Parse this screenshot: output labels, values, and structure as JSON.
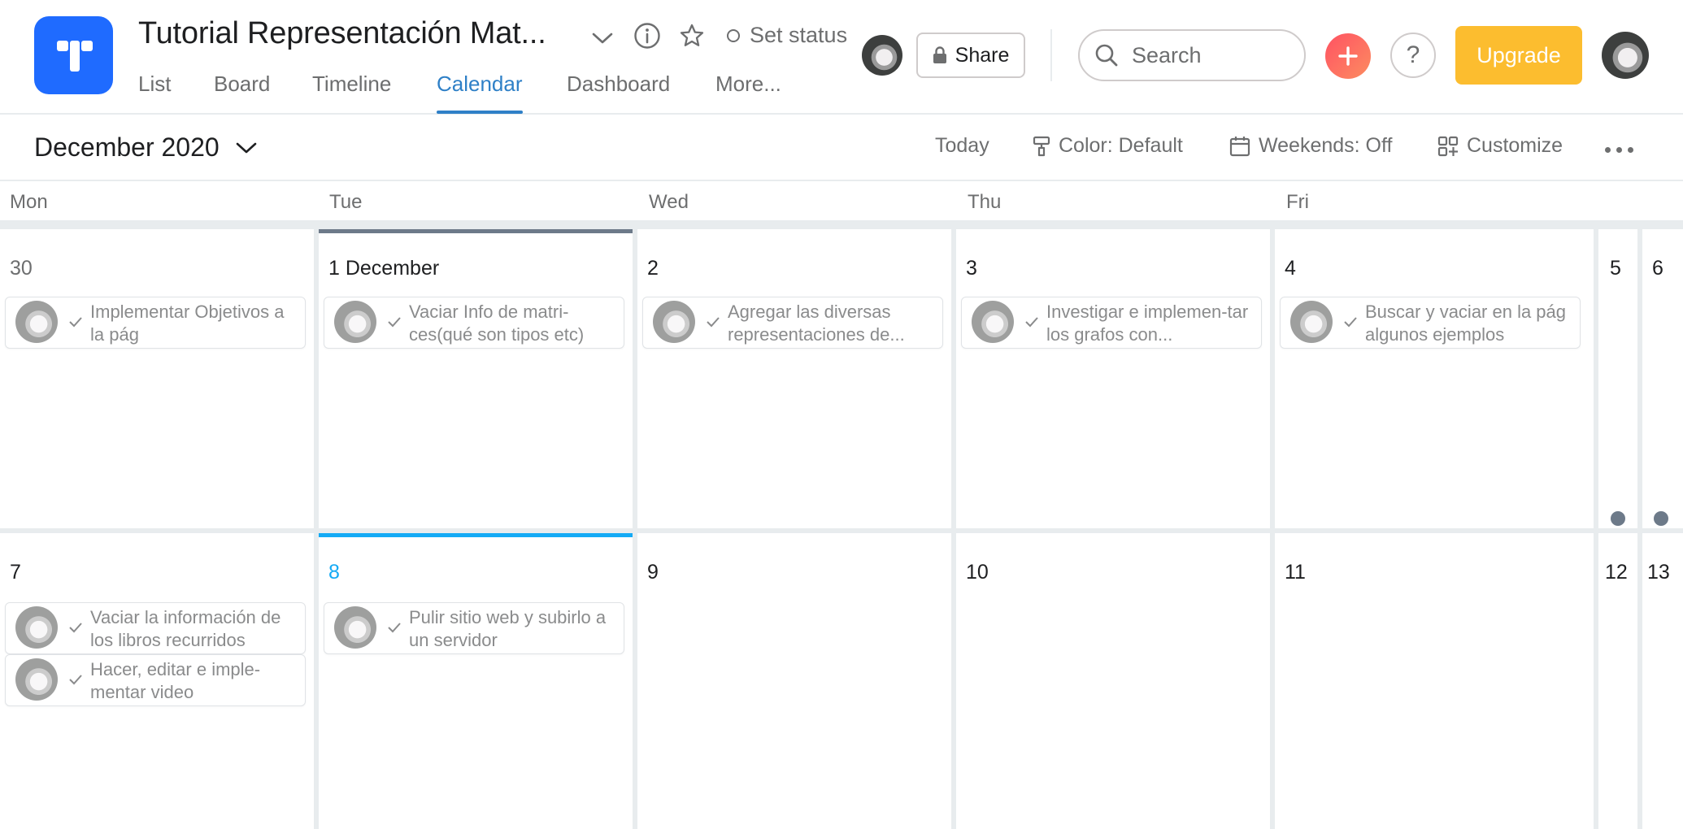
{
  "project": {
    "title": "Tutorial Representación Mat...",
    "set_status": "Set status",
    "share": "Share"
  },
  "tabs": [
    "List",
    "Board",
    "Timeline",
    "Calendar",
    "Dashboard",
    "More..."
  ],
  "active_tab": "Calendar",
  "search": {
    "placeholder": "Search"
  },
  "help": "?",
  "upgrade": "Upgrade",
  "toolbar": {
    "month": "December 2020",
    "today": "Today",
    "color": "Color: Default",
    "weekends": "Weekends: Off",
    "customize": "Customize"
  },
  "day_headers": [
    "Mon",
    "Tue",
    "Wed",
    "Thu",
    "Fri"
  ],
  "weeks": [
    {
      "days": [
        {
          "label": "30",
          "tasks": [
            "Implementar Objetivos a la pág"
          ]
        },
        {
          "label": "1 December",
          "tasks": [
            "Vaciar Info de matri-ces(qué son tipos etc)"
          ]
        },
        {
          "label": "2",
          "tasks": [
            "Agregar las diversas representaciones de..."
          ]
        },
        {
          "label": "3",
          "tasks": [
            "Investigar e implemen-tar los grafos con..."
          ]
        },
        {
          "label": "4",
          "tasks": [
            "Buscar y vaciar en la pág algunos ejemplos"
          ]
        }
      ],
      "weekend": [
        "5",
        "6"
      ]
    },
    {
      "days": [
        {
          "label": "7",
          "tasks": [
            "Vaciar la información de los libros recurridos",
            "Hacer, editar e imple-mentar video"
          ]
        },
        {
          "label": "8",
          "tasks": [
            "Pulir sitio web y subirlo a un servidor"
          ]
        },
        {
          "label": "9",
          "tasks": []
        },
        {
          "label": "10",
          "tasks": []
        },
        {
          "label": "11",
          "tasks": []
        }
      ],
      "weekend": [
        "12",
        "13"
      ]
    }
  ],
  "colors": {
    "accent": "#2f80c7",
    "today": "#14aaf5",
    "logo": "#1f6bff",
    "upgrade": "#fcbd2f",
    "current_week_bar": "#6d7a89"
  },
  "icons": [
    "chevron-down-icon",
    "info-icon",
    "star-icon",
    "lock-icon",
    "search-icon",
    "plus-icon",
    "paint-roller-icon",
    "calendar-icon",
    "grid-plus-icon",
    "more-icon",
    "check-icon"
  ]
}
